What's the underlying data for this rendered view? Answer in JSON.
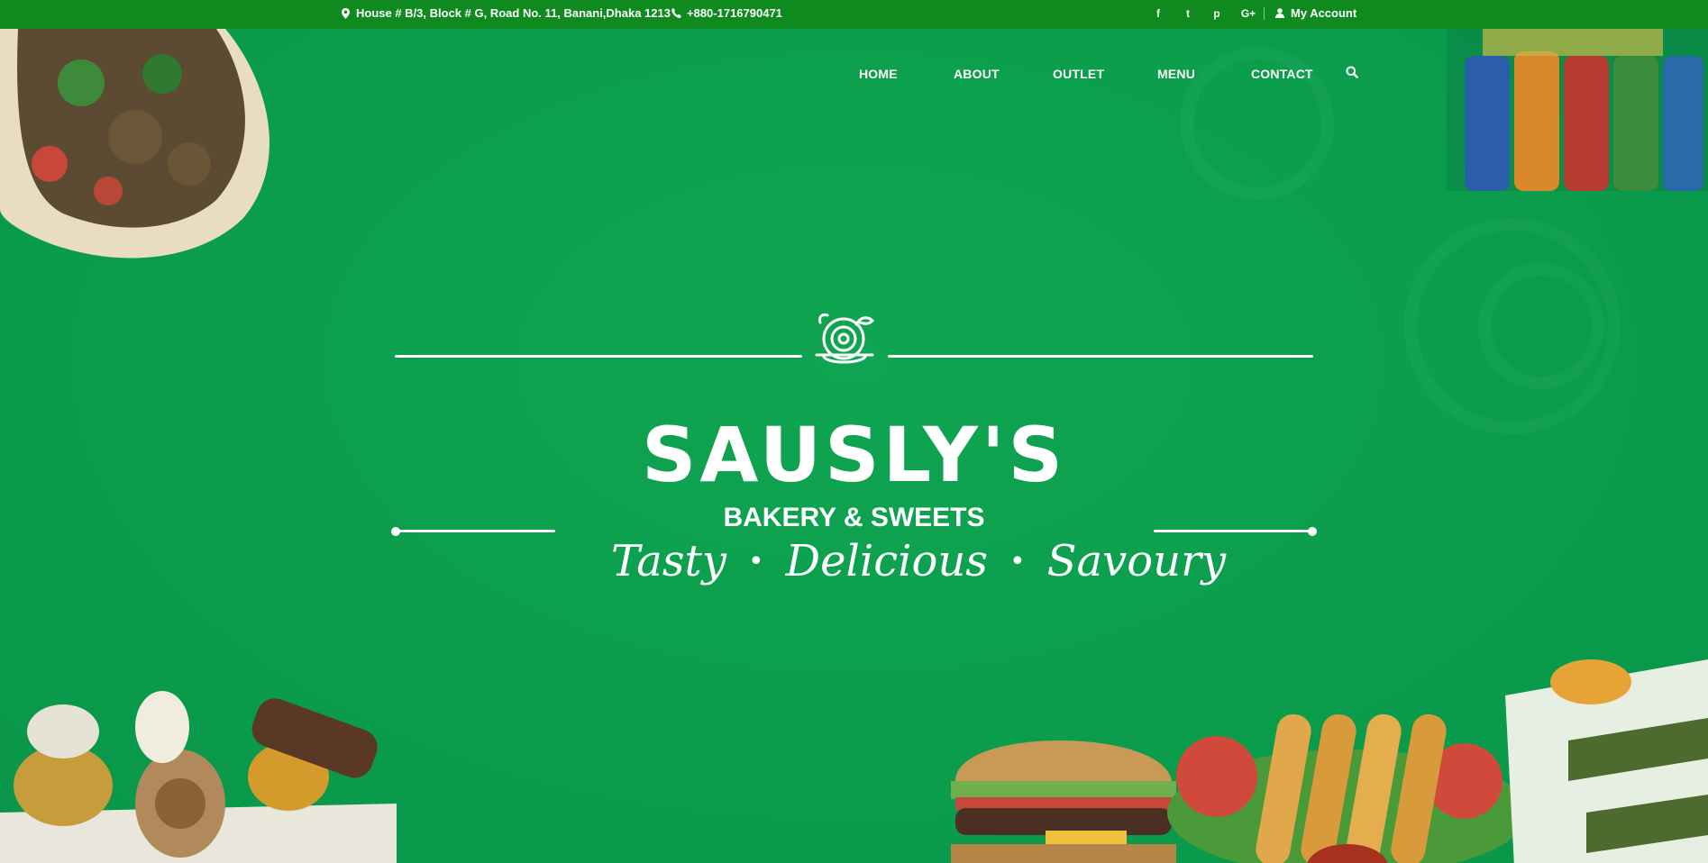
{
  "topbar": {
    "address": "House # B/3, Block # G, Road No. 11, Banani,Dhaka 1213",
    "phone": "+880-1716790471",
    "social": [
      "f",
      "t",
      "p",
      "G+"
    ],
    "account_label": "My Account"
  },
  "nav": {
    "items": [
      "HOME",
      "ABOUT",
      "OUTLET",
      "MENU",
      "CONTACT"
    ]
  },
  "hero": {
    "title": "SAUSLY'S",
    "subtitle": "BAKERY & SWEETS",
    "tagline": [
      "Tasty",
      "Delicious",
      "Savoury"
    ],
    "separator": "•"
  },
  "icons": {
    "location": "map-marker-icon",
    "phone": "phone-icon",
    "user": "user-icon",
    "search": "search-icon",
    "emblem": "food-bowl-icon"
  },
  "colors": {
    "topbar": "#0e8a1e",
    "hero": "#0b9d4c",
    "text": "#ffffff"
  }
}
